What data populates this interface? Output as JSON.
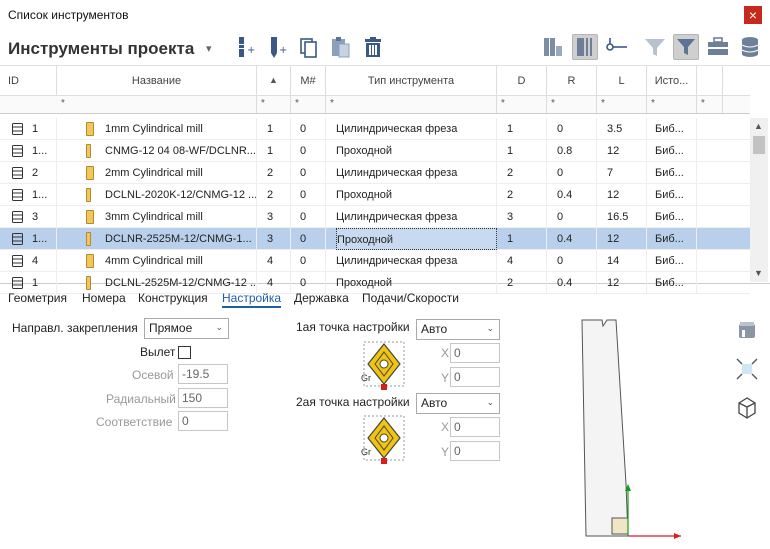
{
  "window": {
    "title": "Список инструментов",
    "close_label": "×"
  },
  "toolbar": {
    "project_title": "Инструменты проекта",
    "dropdown_glyph": "▾",
    "icons": [
      "add-mill-icon",
      "add-turning-icon",
      "copy-icon",
      "paste-icon",
      "delete-icon",
      "tool-assembly-icon",
      "column-select-icon",
      "connect-icon",
      "filter-icon",
      "filter-active-icon",
      "toolbox-icon",
      "database-icon"
    ]
  },
  "table": {
    "columns": [
      "ID",
      "Название",
      "",
      "M#",
      "Тип инструмента",
      "D",
      "R",
      "L",
      "Исто..."
    ],
    "sort_glyph": "▲",
    "filter_glyph": "*",
    "rows": [
      {
        "id": "1",
        "name": "1mm Cylindrical mill",
        "n": "1",
        "m": "0",
        "type": "Цилиндрическая фреза",
        "d": "1",
        "r": "0",
        "l": "3.5",
        "src": "Биб...",
        "kind": "mill"
      },
      {
        "id": "1...",
        "name": "CNMG-12 04 08-WF/DCLNR...",
        "n": "1",
        "m": "0",
        "type": "Проходной",
        "d": "1",
        "r": "0.8",
        "l": "12",
        "src": "Биб...",
        "kind": "turn"
      },
      {
        "id": "2",
        "name": "2mm Cylindrical mill",
        "n": "2",
        "m": "0",
        "type": "Цилиндрическая фреза",
        "d": "2",
        "r": "0",
        "l": "7",
        "src": "Биб...",
        "kind": "mill"
      },
      {
        "id": "1...",
        "name": "DCLNL-2020K-12/CNMG-12 ...",
        "n": "2",
        "m": "0",
        "type": "Проходной",
        "d": "2",
        "r": "0.4",
        "l": "12",
        "src": "Биб...",
        "kind": "turn"
      },
      {
        "id": "3",
        "name": "3mm Cylindrical mill",
        "n": "3",
        "m": "0",
        "type": "Цилиндрическая фреза",
        "d": "3",
        "r": "0",
        "l": "16.5",
        "src": "Биб...",
        "kind": "mill"
      },
      {
        "id": "1...",
        "name": "DCLNR-2525M-12/CNMG-1...",
        "n": "3",
        "m": "0",
        "type": "Проходной",
        "d": "1",
        "r": "0.4",
        "l": "12",
        "src": "Биб...",
        "kind": "turn",
        "selected": true
      },
      {
        "id": "4",
        "name": "4mm Cylindrical mill",
        "n": "4",
        "m": "0",
        "type": "Цилиндрическая фреза",
        "d": "4",
        "r": "0",
        "l": "14",
        "src": "Биб...",
        "kind": "mill"
      },
      {
        "id": "1",
        "name": "DCLNL-2525M-12/CNMG-12 ...",
        "n": "4",
        "m": "0",
        "type": "Проходной",
        "d": "2",
        "r": "0.4",
        "l": "12",
        "src": "Биб...",
        "kind": "turn"
      }
    ]
  },
  "tabs": [
    "Геометрия",
    "Номера",
    "Конструкция",
    "Настройка",
    "Державка",
    "Подачи/Скорости"
  ],
  "active_tab": "Настройка",
  "setup": {
    "clamp_label": "Направл. закрепления",
    "clamp_value": "Прямое",
    "overhang_label": "Вылет",
    "axial_label": "Осевой",
    "axial_value": "-19.5",
    "radial_label": "Радиальный",
    "radial_value": "150",
    "match_label": "Соответствие",
    "match_value": "0",
    "point1_label": "1ая точка настройки",
    "point1_value": "Авто",
    "point2_label": "2ая точка настройки",
    "point2_value": "Авто",
    "x_label": "X",
    "y_label": "Y",
    "x1": "0",
    "y1": "0",
    "x2": "0",
    "y2": "0",
    "insert_tag": "Gr",
    "chevron": "⌄"
  },
  "side_icons": [
    "holder-view-icon",
    "fit-view-icon",
    "3d-view-icon"
  ],
  "colors": {
    "selection": "#b8d0ec",
    "accent": "#1f5fa8",
    "insert": "#f1c40f"
  }
}
